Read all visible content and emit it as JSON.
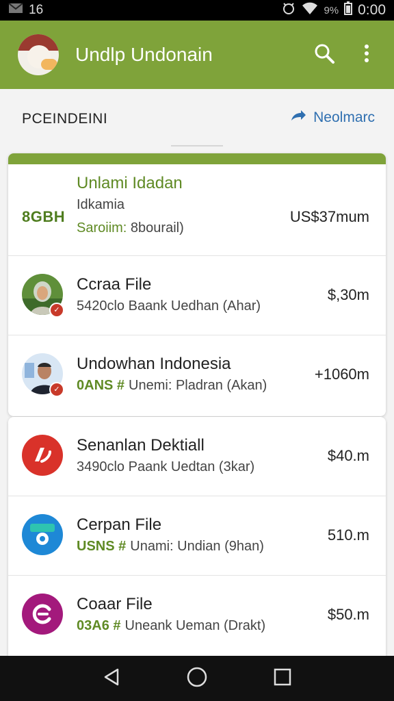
{
  "status_bar": {
    "left_text": "16",
    "battery_percent": "9%",
    "time": "0:00"
  },
  "app_bar": {
    "title": "Undlp Undonain",
    "actions": [
      "search-icon",
      "more-vert-icon"
    ]
  },
  "section": {
    "title": "PCEINDEINI",
    "link_label": "Neolmarc"
  },
  "colors": {
    "brand": "#7fa33a",
    "accent_text": "#5f8a24",
    "link": "#2f6fb0"
  },
  "rows": [
    {
      "code": "8GBH",
      "title": "Unlami Idadan",
      "subtitle": "Idkamia",
      "extra_lead": "Saroiim:",
      "extra_rest": " 8bourail)",
      "amount": "US$37mum"
    },
    {
      "title": "Ccraa File",
      "subtitle": "5420clo Baank Uedhan (Ahar)",
      "amount": "$,30m"
    },
    {
      "title": "Undowhan Indonesia",
      "tag": "0ANS #",
      "subtitle": "Unemi: Pladran (Akan)",
      "amount": "+1060m"
    },
    {
      "title": "Senanlan Dektiall",
      "subtitle": "3490clo Paank Uedtan (3kar)",
      "amount": "$40.m"
    },
    {
      "title": "Cerpan File",
      "tag": "USNS #",
      "subtitle": "Unami: Undian (9han)",
      "amount": "510.m"
    },
    {
      "title": "Coaar File",
      "tag": "03A6 #",
      "subtitle": "Uneank Ueman (Drakt)",
      "amount": "$50.m"
    }
  ],
  "nav": [
    "back-icon",
    "home-icon",
    "recents-icon"
  ]
}
